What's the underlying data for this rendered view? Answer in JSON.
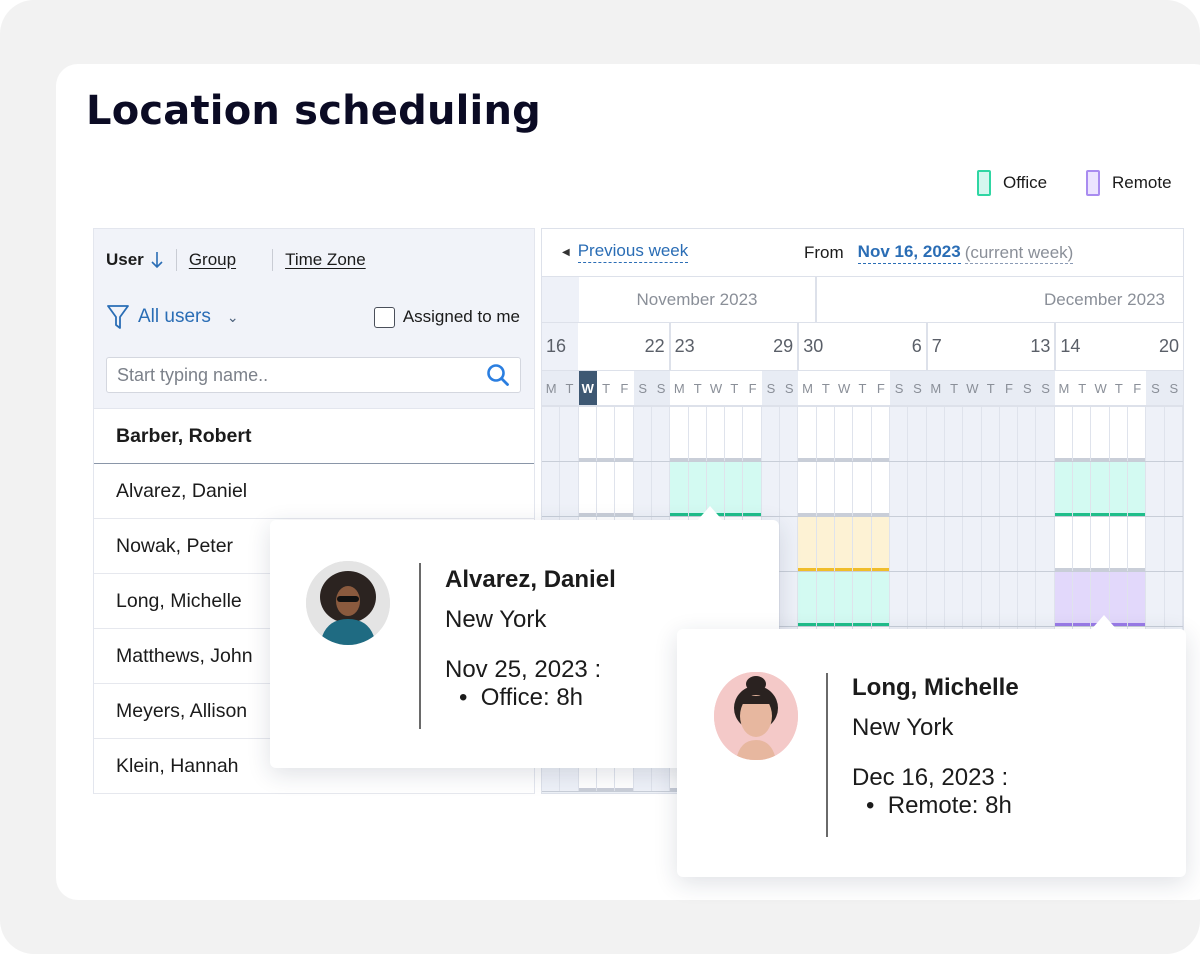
{
  "page": {
    "title": "Location scheduling"
  },
  "legend": [
    {
      "label": "Office",
      "type": "office",
      "color": "#2fd6a3"
    },
    {
      "label": "Remote",
      "type": "remote",
      "color": "#a98cf0"
    }
  ],
  "left": {
    "sort": {
      "user_label": "User",
      "sort_icon": "arrow-down-icon",
      "group_label": "Group",
      "timezone_label": "Time Zone"
    },
    "filter": {
      "label": "All users",
      "icon": "filter-icon"
    },
    "assigned": {
      "label": "Assigned to me",
      "checked": false
    },
    "search": {
      "placeholder": "Start typing name..",
      "value": ""
    },
    "users": [
      "Barber, Robert",
      "Alvarez, Daniel",
      "Nowak, Peter",
      "Long, Michelle",
      "Matthews, John",
      "Meyers, Allison",
      "Klein, Hannah"
    ]
  },
  "calendar": {
    "prev_label": "Previous week",
    "from_label": "From",
    "from_date": "Nov 16, 2023",
    "current_week": "(current week)",
    "months": [
      "November 2023",
      "December 2023"
    ],
    "weeks": [
      {
        "start": "16",
        "end": "22"
      },
      {
        "start": "23",
        "end": "29"
      },
      {
        "start": "30",
        "end": "6"
      },
      {
        "start": "7",
        "end": "13"
      },
      {
        "start": "14",
        "end": "20"
      }
    ],
    "day_letters": [
      "M",
      "T",
      "W",
      "T",
      "F",
      "S",
      "S"
    ],
    "today_index": 2,
    "status_colors": {
      "office": "#1fbe8a",
      "remote": "#9a7ae8",
      "pending": "#f0bd2a"
    },
    "rows": [
      [
        "off",
        "off",
        "work",
        "work",
        "work",
        "off",
        "off",
        "work",
        "work",
        "work",
        "work",
        "work",
        "off",
        "off",
        "work",
        "work",
        "work",
        "work",
        "work",
        "off",
        "off",
        "off",
        "off",
        "off",
        "off",
        "off",
        "off",
        "off",
        "work",
        "work",
        "work",
        "work",
        "work",
        "off",
        "off"
      ],
      [
        "off",
        "off",
        "work",
        "work",
        "work",
        "off",
        "off",
        "office",
        "office",
        "office",
        "office",
        "office",
        "off",
        "off",
        "work",
        "work",
        "work",
        "work",
        "work",
        "off",
        "off",
        "off",
        "off",
        "off",
        "off",
        "off",
        "off",
        "off",
        "office",
        "office",
        "office",
        "office",
        "office",
        "off",
        "off"
      ],
      [
        "off",
        "off",
        "work",
        "work",
        "work",
        "off",
        "off",
        "work",
        "work",
        "work",
        "work",
        "work",
        "off",
        "off",
        "pending",
        "pending",
        "pending",
        "pending",
        "pending",
        "off",
        "off",
        "off",
        "off",
        "off",
        "off",
        "off",
        "off",
        "off",
        "work",
        "work",
        "work",
        "work",
        "work",
        "off",
        "off"
      ],
      [
        "off",
        "off",
        "work",
        "work",
        "work",
        "off",
        "off",
        "work",
        "work",
        "work",
        "work",
        "work",
        "off",
        "off",
        "office",
        "office",
        "office",
        "office",
        "office",
        "off",
        "off",
        "off",
        "off",
        "off",
        "off",
        "off",
        "off",
        "off",
        "remote",
        "remote",
        "remote",
        "remote",
        "remote",
        "off",
        "off"
      ],
      [
        "off",
        "off",
        "work",
        "work",
        "work",
        "off",
        "off",
        "work",
        "work",
        "work",
        "work",
        "work",
        "off",
        "off",
        "work",
        "work",
        "work",
        "work",
        "work",
        "off",
        "off",
        "off",
        "off",
        "off",
        "off",
        "off",
        "off",
        "off",
        "work",
        "work",
        "work",
        "work",
        "work",
        "off",
        "off"
      ],
      [
        "off",
        "off",
        "work",
        "work",
        "work",
        "off",
        "off",
        "work",
        "work",
        "work",
        "work",
        "work",
        "off",
        "off",
        "work",
        "work",
        "work",
        "work",
        "work",
        "off",
        "off",
        "off",
        "off",
        "off",
        "off",
        "off",
        "off",
        "off",
        "work",
        "work",
        "work",
        "work",
        "work",
        "off",
        "off"
      ],
      [
        "off",
        "off",
        "work",
        "work",
        "work",
        "off",
        "off",
        "work",
        "work",
        "work",
        "work",
        "work",
        "off",
        "off",
        "work",
        "work",
        "work",
        "work",
        "work",
        "off",
        "off",
        "off",
        "off",
        "off",
        "off",
        "off",
        "off",
        "off",
        "work",
        "work",
        "work",
        "work",
        "work",
        "off",
        "off"
      ]
    ]
  },
  "popups": [
    {
      "name": "Alvarez, Daniel",
      "location": "New York",
      "date": "Nov 25, 2023 :",
      "entry": "Office: 8h"
    },
    {
      "name": "Long, Michelle",
      "location": "New York",
      "date": "Dec 16, 2023 :",
      "entry": "Remote: 8h"
    }
  ]
}
